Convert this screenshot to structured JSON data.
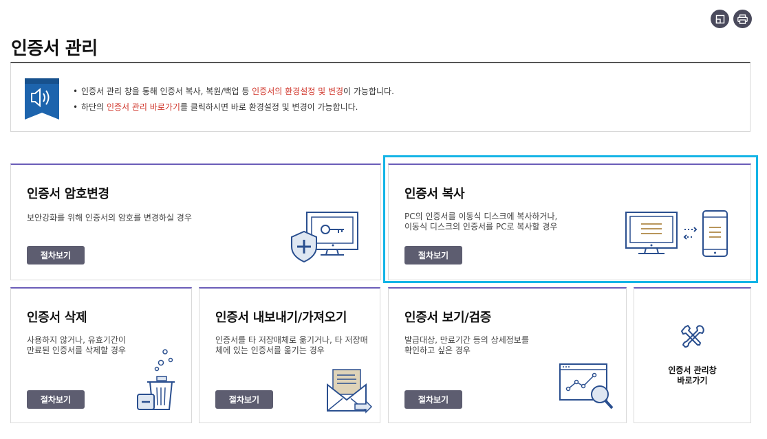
{
  "page": {
    "title": "인증서 관리"
  },
  "toolbar": {
    "expand_icon": "expand-window-icon",
    "print_icon": "printer-icon"
  },
  "info": {
    "icon": "speaker-notice-icon",
    "line1": {
      "a": "인증서 관리 창을 통해 인증서 복사, 복원/백업 등 ",
      "highlight": "인증서의 환경설정 및 변경",
      "b": "이 가능합니다."
    },
    "line2": {
      "a": "하단의 ",
      "highlight": "인증서 관리 바로가기",
      "b": "를 클릭하시면 바로 환경설정 및 변경이 가능합니다."
    }
  },
  "cards": {
    "password": {
      "title": "인증서 암호변경",
      "desc1": "보안강화를 위해 인증서의 암호를 변경하실 경우",
      "desc2": "",
      "button": "절차보기",
      "icon": "monitor-key-shield-icon"
    },
    "copy": {
      "title": "인증서 복사",
      "desc1": "PC의 인증서를 이동식 디스크에 복사하거나,",
      "desc2": "이동식 디스크의 인증서를  PC로 복사할 경우",
      "button": "절차보기",
      "icon": "pc-to-phone-transfer-icon"
    },
    "delete": {
      "title": "인증서 삭제",
      "desc1": "사용하지 않거나, 유효기간이",
      "desc2": "만료된 인증서를 삭제할 경우",
      "button": "절차보기",
      "icon": "trash-bin-icon"
    },
    "export": {
      "title": "인증서 내보내기/가져오기",
      "desc1": "인증서를 타 저장매체로 옮기거나, 타 저장매",
      "desc2": "체에 있는 인증서를 옮기는 경우",
      "button": "절차보기",
      "icon": "envelope-export-icon"
    },
    "view": {
      "title": "인증서 보기/검증",
      "desc1": "발급대상, 만료기간 등의 상세정보를",
      "desc2": "확인하고 싶은 경우",
      "button": "절차보기",
      "icon": "chart-magnifier-icon"
    }
  },
  "shortcut": {
    "label": "인증서 관리창\n바로가기",
    "icon": "tools-icon"
  },
  "colors": {
    "accent_border": "#6a5cb8",
    "highlight": "#14b4e6",
    "button": "#5d5d70",
    "red_text": "#d0362b",
    "icon_blue": "#2a4f8f"
  }
}
